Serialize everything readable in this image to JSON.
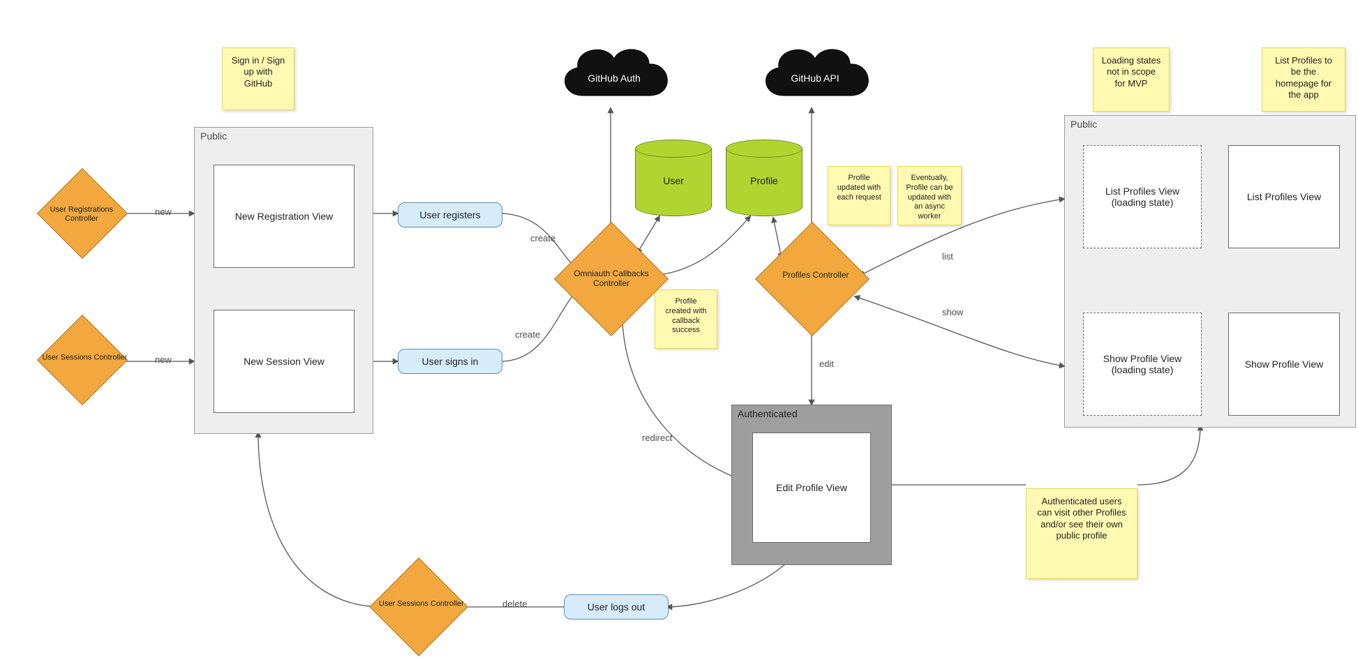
{
  "notes": {
    "signin": "Sign in / Sign up with GitHub",
    "profile_callback": "Profile created with callback success",
    "profile_updated": "Profile updated with each request",
    "async_worker": "Eventually, Profile can be updated with an async worker",
    "loading_states": "Loading states not in scope for MVP",
    "list_homepage": "List Profiles to be the homepage for the app",
    "auth_visit": "Authenticated users can visit other Profiles and/or see their own public profile"
  },
  "groups": {
    "public_left": "Public",
    "authenticated": "Authenticated",
    "public_right": "Public"
  },
  "controllers": {
    "user_registrations": "User Registrations Controller",
    "user_sessions_top": "User Sessions Controller",
    "omniauth": "Omniauth Callbacks Controller",
    "profiles": "Profiles Controller",
    "user_sessions_bot": "User Sessions Controller"
  },
  "views": {
    "new_registration": "New Registration View",
    "new_session": "New Session View",
    "edit_profile": "Edit Profile View",
    "list_loading": "List Profiles View (loading state)",
    "list_profiles": "List Profiles View",
    "show_loading": "Show Profile View (loading state)",
    "show_profile": "Show Profile View"
  },
  "actions": {
    "user_registers": "User registers",
    "user_signs_in": "User signs in",
    "user_logs_out": "User logs out"
  },
  "clouds": {
    "github_auth": "GitHub Auth",
    "github_api": "GitHub API"
  },
  "datastores": {
    "user": "User",
    "profile": "Profile"
  },
  "edges": {
    "new1": "new",
    "new2": "new",
    "create1": "create",
    "create2": "create",
    "redirect": "redirect",
    "edit": "edit",
    "delete": "delete",
    "list": "list",
    "show": "show"
  }
}
